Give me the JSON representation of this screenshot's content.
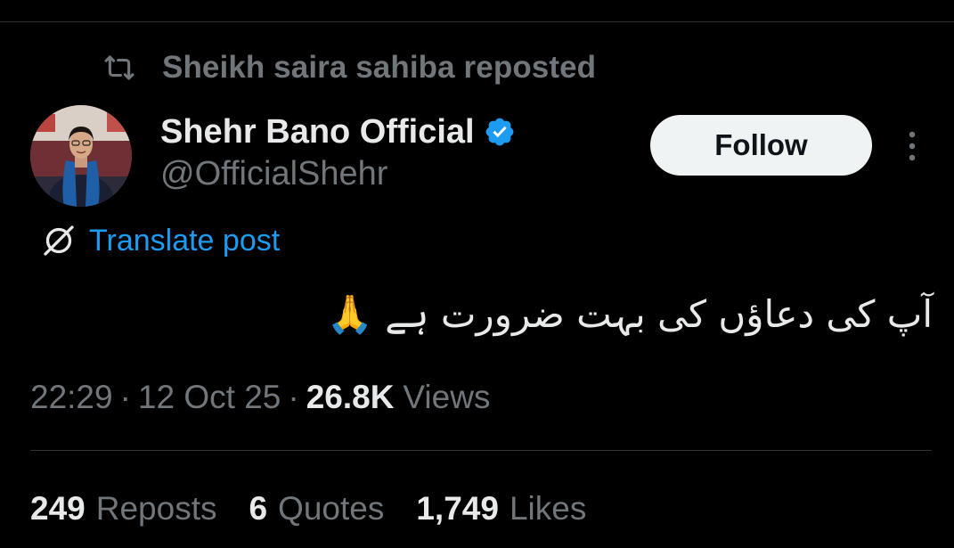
{
  "colors": {
    "background": "#000000",
    "text_primary": "#e7e9ea",
    "text_secondary": "#71767b",
    "accent": "#1d9bf0",
    "follow_button_bg": "#eff3f4",
    "follow_button_text": "#0f1419",
    "divider": "#2f3336"
  },
  "repost_context": {
    "icon": "repost-icon",
    "text": "Sheikh saira sahiba reposted"
  },
  "author": {
    "avatar": "profile-photo",
    "display_name": "Shehr Bano Official",
    "verified_icon": "verified-badge-icon",
    "handle": "@OfficialShehr"
  },
  "actions": {
    "follow_label": "Follow",
    "more_icon": "more-options-icon"
  },
  "translate": {
    "icon": "translate-globe-icon",
    "label": "Translate post"
  },
  "post": {
    "text": "آپ کی دعاؤں کی بہت ضرورت ہے 🙏"
  },
  "meta": {
    "time": "22:29",
    "separator": "·",
    "date": "12 Oct 25",
    "views_count": "26.8K",
    "views_label": "Views"
  },
  "stats": [
    {
      "count": "249",
      "label": "Reposts"
    },
    {
      "count": "6",
      "label": "Quotes"
    },
    {
      "count": "1,749",
      "label": "Likes"
    }
  ]
}
